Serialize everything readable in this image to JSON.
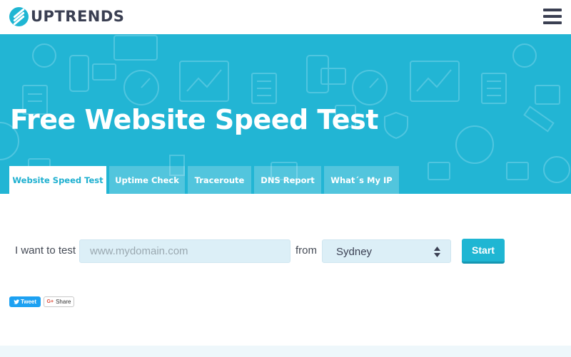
{
  "header": {
    "logo_text": "UPTRENDS",
    "menu_icon": "hamburger-menu-icon"
  },
  "hero": {
    "title": "Free Website Speed Test",
    "background_color": "#22b5d4",
    "tabs": [
      {
        "label": "Website Speed Test",
        "active": true
      },
      {
        "label": "Uptime Check",
        "active": false
      },
      {
        "label": "Traceroute",
        "active": false
      },
      {
        "label": "DNS Report",
        "active": false
      },
      {
        "label": "What´s My IP",
        "active": false
      }
    ]
  },
  "form": {
    "prefix_label": "I want to test",
    "url_placeholder": "www.mydomain.com",
    "url_value": "",
    "from_label": "from",
    "location_value": "Sydney",
    "start_label": "Start"
  },
  "social": {
    "tweet_label": "Tweet",
    "share_label": "Share",
    "gplus_label": "G+"
  },
  "colors": {
    "accent": "#1fb6d3",
    "dark_text": "#3a3f52",
    "input_bg": "#dceff7"
  }
}
